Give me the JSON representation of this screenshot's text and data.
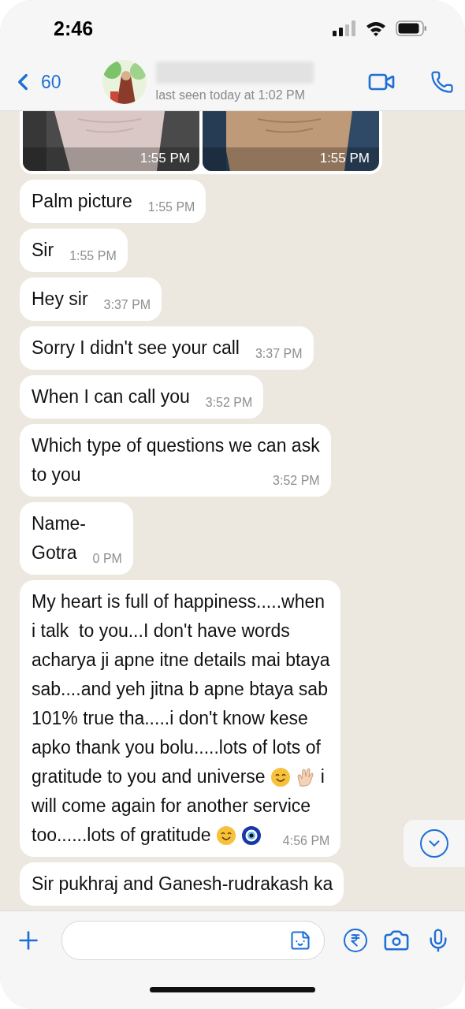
{
  "status_bar": {
    "time": "2:46"
  },
  "header": {
    "back_count": "60",
    "status": "last seen today at 1:02 PM"
  },
  "messages": [
    {
      "kind": "images",
      "images": [
        {
          "time": "1:55 PM"
        },
        {
          "time": "1:55 PM"
        }
      ]
    },
    {
      "kind": "text",
      "lines": [
        [
          {
            "kind": "text",
            "text": "Palm picture"
          }
        ]
      ],
      "time": "1:55 PM"
    },
    {
      "kind": "text",
      "lines": [
        [
          {
            "kind": "text",
            "text": "Sir"
          }
        ]
      ],
      "time": "1:55 PM"
    },
    {
      "kind": "text",
      "lines": [
        [
          {
            "kind": "text",
            "text": "Hey sir"
          }
        ]
      ],
      "time": "3:37 PM"
    },
    {
      "kind": "text",
      "lines": [
        [
          {
            "kind": "text",
            "text": "Sorry I didn't see your call"
          }
        ]
      ],
      "time": "3:37 PM"
    },
    {
      "kind": "text",
      "lines": [
        [
          {
            "kind": "text",
            "text": "When I can call you"
          }
        ]
      ],
      "time": "3:52 PM"
    },
    {
      "kind": "text",
      "lines": [
        [
          {
            "kind": "text",
            "text": "Which type of questions we can ask"
          }
        ],
        [
          {
            "kind": "text",
            "text": "to you"
          }
        ]
      ],
      "time": "3:52 PM"
    },
    {
      "kind": "text",
      "lines": [
        [
          {
            "kind": "text",
            "text": "Name-"
          }
        ],
        [
          {
            "kind": "text",
            "text": "Gotra"
          }
        ]
      ],
      "time": "0 PM"
    },
    {
      "kind": "text",
      "lines": [
        [
          {
            "kind": "text",
            "text": "My heart is full of happiness.....when"
          }
        ],
        [
          {
            "kind": "text",
            "text": "i talk  to you...I don't have words"
          }
        ],
        [
          {
            "kind": "text",
            "text": "acharya ji apne itne details mai btaya"
          }
        ],
        [
          {
            "kind": "text",
            "text": "sab....and yeh jitna b apne btaya sab"
          }
        ],
        [
          {
            "kind": "text",
            "text": "101% true tha.....i don't know kese"
          }
        ],
        [
          {
            "kind": "text",
            "text": "apko thank you bolu.....lots of lots of"
          }
        ],
        [
          {
            "kind": "text",
            "text": "gratitude to you and universe"
          },
          {
            "kind": "smile"
          },
          {
            "kind": "clap"
          },
          {
            "kind": "text",
            "text": "i"
          }
        ],
        [
          {
            "kind": "text",
            "text": "will come again for another service"
          }
        ],
        [
          {
            "kind": "text",
            "text": "too......lots of gratitude"
          },
          {
            "kind": "smile"
          },
          {
            "kind": "eye"
          }
        ]
      ],
      "time": "4:56 PM"
    },
    {
      "kind": "text",
      "lines": [
        [
          {
            "kind": "text",
            "text": "Sir pukhraj and Ganesh-rudrakash ka"
          }
        ]
      ]
    }
  ]
}
